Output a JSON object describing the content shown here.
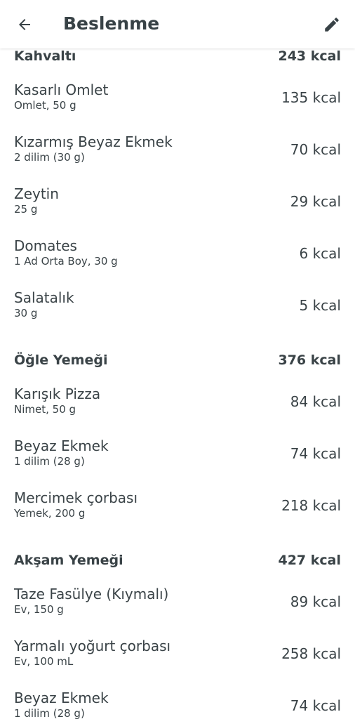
{
  "appbar": {
    "title": "Beslenme"
  },
  "sections": [
    {
      "title": "Kahvaltı",
      "total": "243 kcal",
      "items": [
        {
          "name": "Kasarlı Omlet",
          "detail": "Omlet, 50 g",
          "kcal": "135 kcal"
        },
        {
          "name": "Kızarmış Beyaz Ekmek",
          "detail": "2 dilim (30 g)",
          "kcal": "70 kcal"
        },
        {
          "name": "Zeytin",
          "detail": "25 g",
          "kcal": "29 kcal"
        },
        {
          "name": "Domates",
          "detail": "1 Ad Orta Boy, 30 g",
          "kcal": "6 kcal"
        },
        {
          "name": "Salatalık",
          "detail": "30 g",
          "kcal": "5 kcal"
        }
      ]
    },
    {
      "title": "Öğle Yemeği",
      "total": "376 kcal",
      "items": [
        {
          "name": "Karışık Pizza",
          "detail": "Nimet, 50 g",
          "kcal": "84 kcal"
        },
        {
          "name": "Beyaz Ekmek",
          "detail": "1 dilim (28 g)",
          "kcal": "74 kcal"
        },
        {
          "name": "Mercimek çorbası",
          "detail": "Yemek, 200 g",
          "kcal": "218 kcal"
        }
      ]
    },
    {
      "title": "Akşam Yemeği",
      "total": "427 kcal",
      "items": [
        {
          "name": "Taze Fasülye (Kıymalı)",
          "detail": "Ev, 150 g",
          "kcal": "89 kcal"
        },
        {
          "name": "Yarmalı yoğurt çorbası",
          "detail": "Ev, 100 mL",
          "kcal": "258 kcal"
        },
        {
          "name": "Beyaz Ekmek",
          "detail": "1 dilim (28 g)",
          "kcal": "74 kcal"
        }
      ]
    }
  ],
  "icons": {
    "back": "arrow-back-icon",
    "edit": "pencil-icon"
  },
  "colors": {
    "text": "#3a4347",
    "background": "#ffffff"
  }
}
